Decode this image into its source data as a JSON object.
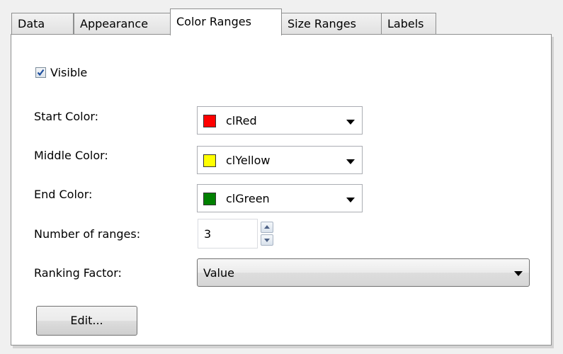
{
  "tabs": [
    {
      "label": "Data",
      "active": false
    },
    {
      "label": "Appearance",
      "active": false
    },
    {
      "label": "Color Ranges",
      "active": true
    },
    {
      "label": "Size Ranges",
      "active": false
    },
    {
      "label": "Labels",
      "active": false
    }
  ],
  "visible": {
    "label": "Visible",
    "checked": true
  },
  "start_color": {
    "label": "Start Color:",
    "value": "clRed",
    "swatch": "#ff0000"
  },
  "middle_color": {
    "label": "Middle Color:",
    "value": "clYellow",
    "swatch": "#ffff00"
  },
  "end_color": {
    "label": "End Color:",
    "value": "clGreen",
    "swatch": "#008000"
  },
  "number_of_ranges": {
    "label": "Number of ranges:",
    "value": "3"
  },
  "ranking_factor": {
    "label": "Ranking Factor:",
    "value": "Value"
  },
  "edit_button": {
    "label": "Edit..."
  },
  "colors": {
    "border": "#8e8f8f",
    "panel": "#ffffff",
    "check": "#1e4f9e"
  }
}
